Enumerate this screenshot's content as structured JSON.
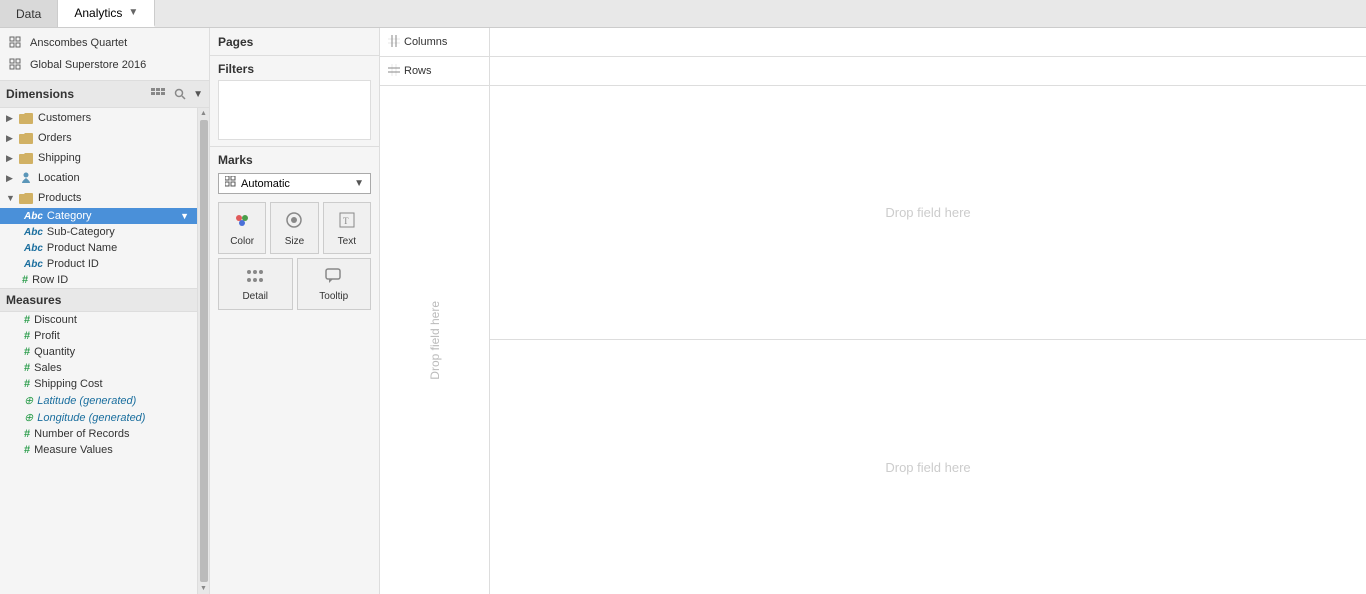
{
  "tabs": [
    {
      "id": "data",
      "label": "Data",
      "active": false
    },
    {
      "id": "analytics",
      "label": "Analytics",
      "active": true,
      "hasDropdown": true
    }
  ],
  "data_sources": [
    {
      "id": "anscombe",
      "label": "Anscombes Quartet",
      "icon": "grid"
    },
    {
      "id": "global",
      "label": "Global Superstore 2016",
      "icon": "grid"
    }
  ],
  "dimensions_header": "Dimensions",
  "dimensions_groups": [
    {
      "id": "customers",
      "label": "Customers",
      "expanded": false,
      "icon": "folder"
    },
    {
      "id": "orders",
      "label": "Orders",
      "expanded": false,
      "icon": "folder"
    },
    {
      "id": "shipping",
      "label": "Shipping",
      "expanded": false,
      "icon": "folder"
    },
    {
      "id": "location",
      "label": "Location",
      "expanded": false,
      "icon": "person"
    },
    {
      "id": "products",
      "label": "Products",
      "expanded": true,
      "icon": "folder",
      "children": [
        {
          "id": "category",
          "label": "Category",
          "type": "Abc",
          "selected": true
        },
        {
          "id": "sub-category",
          "label": "Sub-Category",
          "type": "Abc",
          "selected": false
        },
        {
          "id": "product-name",
          "label": "Product Name",
          "type": "Abc",
          "selected": false
        },
        {
          "id": "product-id",
          "label": "Product ID",
          "type": "Abc",
          "selected": false
        }
      ]
    },
    {
      "id": "row-id",
      "label": "Row ID",
      "type": "hash",
      "selected": false
    }
  ],
  "measures_header": "Measures",
  "measures": [
    {
      "id": "discount",
      "label": "Discount",
      "type": "hash"
    },
    {
      "id": "profit",
      "label": "Profit",
      "type": "hash"
    },
    {
      "id": "quantity",
      "label": "Quantity",
      "type": "hash"
    },
    {
      "id": "sales",
      "label": "Sales",
      "type": "hash"
    },
    {
      "id": "shipping-cost",
      "label": "Shipping Cost",
      "type": "hash"
    },
    {
      "id": "latitude",
      "label": "Latitude (generated)",
      "type": "globe",
      "italic": true
    },
    {
      "id": "longitude",
      "label": "Longitude (generated)",
      "type": "globe",
      "italic": true
    },
    {
      "id": "number-of-records",
      "label": "Number of Records",
      "type": "hash"
    },
    {
      "id": "measure-values",
      "label": "Measure Values",
      "type": "hash"
    }
  ],
  "filter_title": "Filters",
  "marks_title": "Marks",
  "marks_dropdown": {
    "icon": "grid",
    "label": "Automatic"
  },
  "mark_buttons": [
    {
      "id": "color",
      "label": "Color",
      "icon": "color"
    },
    {
      "id": "size",
      "label": "Size",
      "icon": "size"
    },
    {
      "id": "text",
      "label": "Text",
      "icon": "text"
    },
    {
      "id": "detail",
      "label": "Detail",
      "icon": "detail"
    },
    {
      "id": "tooltip",
      "label": "Tooltip",
      "icon": "tooltip"
    }
  ],
  "pages_label": "Pages",
  "canvas": {
    "columns_label": "Columns",
    "rows_label": "Rows",
    "drop_field_here_top": "Drop field here",
    "drop_field_here_right": "Drop field here",
    "drop_field_vertical": "Drop field here"
  }
}
